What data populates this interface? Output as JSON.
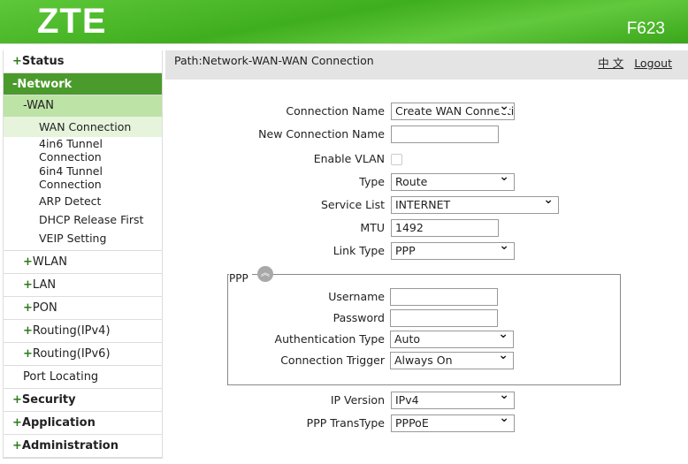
{
  "header": {
    "logo": "ZTE",
    "model": "F623"
  },
  "sidebar": {
    "status": "Status",
    "network": "-Network",
    "wan": "-WAN",
    "wan_items": [
      "WAN Connection",
      "4in6 Tunnel Connection",
      "6in4 Tunnel Connection",
      "ARP Detect",
      "DHCP Release First",
      "VEIP Setting"
    ],
    "network_items": [
      "WLAN",
      "LAN",
      "PON",
      "Routing(IPv4)",
      "Routing(IPv6)"
    ],
    "port_locating": "Port Locating",
    "security": "Security",
    "application": "Application",
    "administration": "Administration",
    "plus": "+"
  },
  "path": "Path:Network-WAN-WAN Connection",
  "links": {
    "chinese": "中 文",
    "logout": "Logout"
  },
  "form": {
    "connection_name": {
      "label": "Connection Name",
      "value": "Create WAN Connection"
    },
    "new_connection_name": {
      "label": "New Connection Name",
      "value": ""
    },
    "enable_vlan": {
      "label": "Enable VLAN",
      "checked": false
    },
    "type": {
      "label": "Type",
      "value": "Route"
    },
    "service_list": {
      "label": "Service List",
      "value": "INTERNET"
    },
    "mtu": {
      "label": "MTU",
      "value": "1492"
    },
    "link_type": {
      "label": "Link Type",
      "value": "PPP"
    },
    "ppp": {
      "legend": "PPP",
      "username": {
        "label": "Username",
        "value": ""
      },
      "password": {
        "label": "Password",
        "value": ""
      },
      "auth_type": {
        "label": "Authentication Type",
        "value": "Auto"
      },
      "trigger": {
        "label": "Connection Trigger",
        "value": "Always On"
      }
    },
    "ip_version": {
      "label": "IP Version",
      "value": "IPv4"
    },
    "ppp_transtype": {
      "label": "PPP TransType",
      "value": "PPPoE"
    }
  }
}
